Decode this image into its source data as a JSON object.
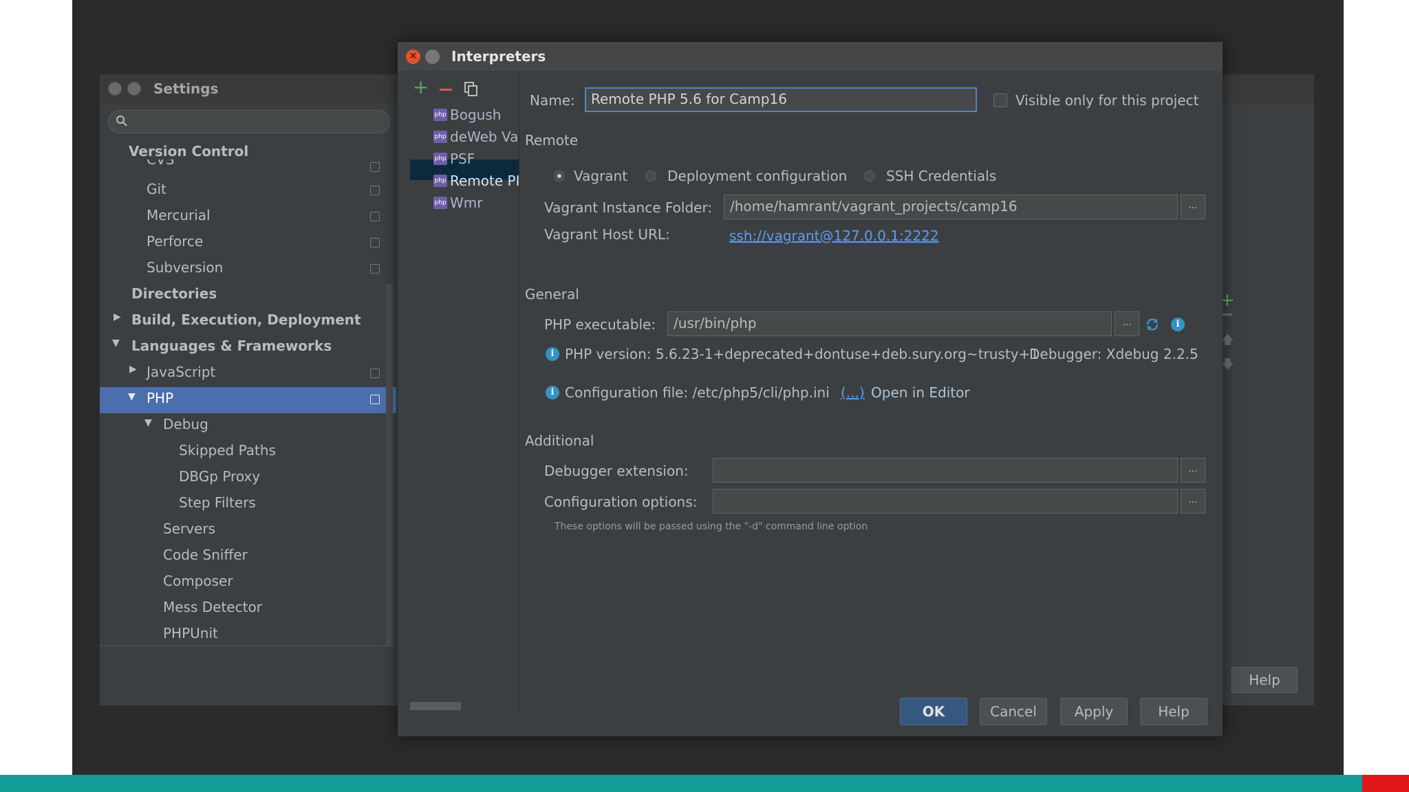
{
  "settings": {
    "title": "Settings",
    "tree": [
      {
        "label": "Version Control",
        "bold": true
      },
      {
        "label": "CVS"
      },
      {
        "label": "Git"
      },
      {
        "label": "Mercurial"
      },
      {
        "label": "Perforce"
      },
      {
        "label": "Subversion"
      },
      {
        "label": "Directories",
        "bold": true
      },
      {
        "label": "Build, Execution, Deployment",
        "bold": true
      },
      {
        "label": "Languages & Frameworks",
        "bold": true
      },
      {
        "label": "JavaScript"
      },
      {
        "label": "PHP"
      },
      {
        "label": "Debug"
      },
      {
        "label": "Skipped Paths"
      },
      {
        "label": "DBGp Proxy"
      },
      {
        "label": "Step Filters"
      },
      {
        "label": "Servers"
      },
      {
        "label": "Code Sniffer"
      },
      {
        "label": "Composer"
      },
      {
        "label": "Mess Detector"
      },
      {
        "label": "PHPUnit"
      }
    ],
    "help_label": "Help"
  },
  "dialog": {
    "title": "Interpreters",
    "interpreters": [
      "Bogush",
      "deWeb Va",
      "PSF",
      "Remote PI",
      "Wmr"
    ],
    "name_label": "Name:",
    "name_value": "Remote PHP 5.6 for Camp16",
    "visible_only_label": "Visible only for this project",
    "remote_section": "Remote",
    "radio_vagrant": "Vagrant",
    "radio_deployment": "Deployment configuration",
    "radio_ssh": "SSH Credentials",
    "vagrant_folder_label": "Vagrant Instance Folder:",
    "vagrant_folder_value": "/home/hamrant/vagrant_projects/camp16",
    "vagrant_host_label": "Vagrant Host URL:",
    "vagrant_host_value": "ssh://vagrant@127.0.0.1:2222",
    "general_section": "General",
    "php_exec_label": "PHP executable:",
    "php_exec_value": "/usr/bin/php",
    "php_version_text": "PHP version: 5.6.23-1+deprecated+dontuse+deb.sury.org~trusty+1",
    "debugger_text": "Debugger:  Xdebug 2.2.5",
    "config_file_text": "Configuration file: /etc/php5/cli/php.ini",
    "config_file_link": "(...)",
    "open_in_editor": "Open in Editor",
    "additional_section": "Additional",
    "debugger_ext_label": "Debugger extension:",
    "config_options_label": "Configuration options:",
    "hint_text": "These options will be passed using the \"-d\" command line option",
    "browse_label": "...",
    "buttons": {
      "ok": "OK",
      "cancel": "Cancel",
      "apply": "Apply",
      "help": "Help"
    }
  },
  "colors": {
    "accent": "#4b6eaf",
    "link": "#589df6",
    "add": "#59a869",
    "remove": "#e05555"
  }
}
